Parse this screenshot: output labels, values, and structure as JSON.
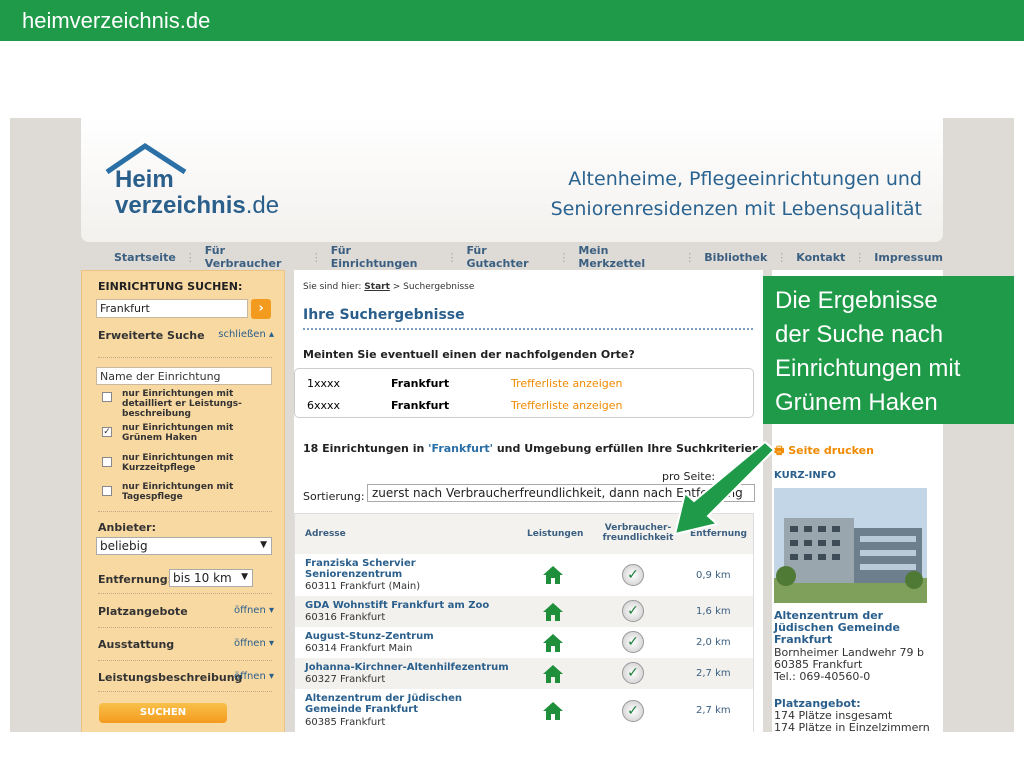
{
  "slide": {
    "title": "heimverzeichnis.de"
  },
  "callout": {
    "lines": [
      "Die Ergebnisse",
      "der Suche nach",
      "Einrichtungen mit",
      "Grünem Haken"
    ]
  },
  "site": {
    "logo": {
      "line1": "Heim",
      "line2_main": "verzeichnis",
      "line2_suffix": ".de"
    },
    "tagline": [
      "Altenheime, Pflegeeinrichtungen und",
      "Seniorenresidenzen mit Lebensqualität"
    ],
    "nav": [
      "Startseite",
      "Für Verbraucher",
      "Für Einrichtungen",
      "Für Gutachter",
      "Mein Merkzettel",
      "Bibliothek",
      "Kontakt",
      "Impressum"
    ],
    "sidebar": {
      "heading": "EINRICHTUNG SUCHEN:",
      "search_value": "Frankfurt",
      "go": "›",
      "advanced": "Erweiterte Suche",
      "advanced_link": "schließen ▴",
      "name_placeholder": "Name der Einrichtung",
      "checks": [
        {
          "label": "nur Einrichtungen mit detailliert er Leistungs-beschreibung",
          "checked": false
        },
        {
          "label": "nur Einrichtungen mit Grünem Haken",
          "checked": true
        },
        {
          "label": "nur Einrichtungen mit Kurzzeitpflege",
          "checked": false
        },
        {
          "label": "nur Einrichtungen mit Tagespflege",
          "checked": false
        }
      ],
      "anbieter_label": "Anbieter:",
      "anbieter_value": "beliebig",
      "entfernung_label": "Entfernung:",
      "entfernung_value": "bis 10 km",
      "platz": "Platzangebote",
      "ausstattung": "Ausstattung",
      "leistung": "Leistungsbeschreibung",
      "open_link": "öffnen ▾",
      "search_button": "SUCHEN"
    },
    "main": {
      "breadcrumb_prefix": "Sie sind hier:",
      "breadcrumb_start": "Start",
      "breadcrumb_current": "> Suchergebnisse",
      "heading": "Ihre Suchergebnisse",
      "meinten": "Meinten Sie eventuell einen der nachfolgenden Orte?",
      "options": [
        {
          "code": "1xxxx",
          "city": "Frankfurt",
          "link": "Trefferliste anzeigen"
        },
        {
          "code": "6xxxx",
          "city": "Frankfurt",
          "link": "Trefferliste anzeigen"
        }
      ],
      "found_pre": "18 Einrichtungen in ",
      "found_q": "'Frankfurt'",
      "found_post": " und Umgebung erfüllen Ihre Suchkriterien",
      "pro_seite": "pro Seite:",
      "sort_label": "Sortierung:",
      "sort_value": "zuerst nach Verbraucherfreundlichkeit, dann nach Entfernung",
      "table_headers": {
        "adresse": "Adresse",
        "leistungen": "Leistungen",
        "verbraucher": "Verbraucher-freundlichkeit",
        "entfernung": "Entfernung"
      },
      "rows": [
        {
          "name": "Franziska Schervier Seniorenzentrum",
          "addr": "60311 Frankfurt (Main)",
          "km": "0,9 km"
        },
        {
          "name": "GDA Wohnstift Frankfurt am Zoo",
          "addr": "60316 Frankfurt",
          "km": "1,6 km"
        },
        {
          "name": "August-Stunz-Zentrum",
          "addr": "60314 Frankfurt Main",
          "km": "2,0 km"
        },
        {
          "name": "Johanna-Kirchner-Altenhilfezentrum",
          "addr": "60327 Frankfurt",
          "km": "2,7 km"
        },
        {
          "name": "Altenzentrum der Jüdischen Gemeinde Frankfurt",
          "addr": "60385 Frankfurt",
          "km": "2,7 km"
        }
      ]
    },
    "right": {
      "print": "Seite drucken",
      "kurz": "KURZ-INFO",
      "name": [
        "Altenzentrum der",
        "Jüdischen Gemeinde",
        "Frankfurt"
      ],
      "street": "Bornheimer Landwehr 79 b",
      "city": "60385 Frankfurt",
      "tel": "Tel.: 069-40560-0",
      "platz_label": "Platzangebot:",
      "platz_total": "174 Plätze insgesamt",
      "platz_single": "174 Plätze in Einzelzimmern"
    }
  },
  "colors": {
    "green": "#1f9a48",
    "blue": "#2a5f8c",
    "orange": "#f08a00"
  }
}
